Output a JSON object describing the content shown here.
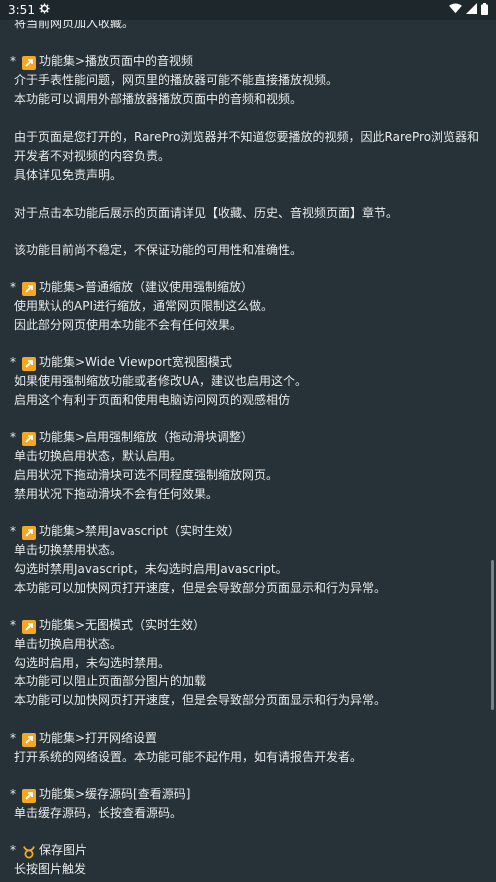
{
  "status_bar": {
    "time": "3:51"
  },
  "content": {
    "intro_tail": "将当前网页加入收藏。",
    "media": {
      "title": "功能集>播放页面中的音视频",
      "l1": "介于手表性能问题，网页里的播放器可能不能直接播放视频。",
      "l2": "本功能可以调用外部播放器播放页面中的音频和视频。",
      "disclaimer": "由于页面是您打开的，RarePro浏览器并不知道您要播放的视频，因此RarePro浏览器和开发者不对视频的内容负责。",
      "detail": "具体详见免责声明。",
      "see_also": "对于点击本功能后展示的页面请详见【收藏、历史、音视频页面】章节。",
      "unstable": "该功能目前尚不稳定，不保证功能的可用性和准确性。"
    },
    "zoom": {
      "title": "功能集>普通缩放（建议使用强制缩放）",
      "l1": "使用默认的API进行缩放，通常网页限制这么做。",
      "l2": "因此部分网页使用本功能不会有任何效果。"
    },
    "viewport": {
      "title": "功能集>Wide Viewport宽视图模式",
      "l1": "如果使用强制缩放功能或者修改UA，建议也启用这个。",
      "l2": "启用这个有利于页面和使用电脑访问网页的观感相仿"
    },
    "force_zoom": {
      "title": "功能集>启用强制缩放（拖动滑块调整）",
      "l1": "单击切换启用状态，默认启用。",
      "l2": "启用状况下拖动滑块可选不同程度强制缩放网页。",
      "l3": "禁用状况下拖动滑块不会有任何效果。"
    },
    "js": {
      "title": "功能集>禁用Javascript（实时生效）",
      "l1": "单击切换禁用状态。",
      "l2": "勾选时禁用Javascript，未勾选时启用Javascript。",
      "l3": "本功能可以加快网页打开速度，但是会导致部分页面显示和行为异常。"
    },
    "noimg": {
      "title": "功能集>无图模式（实时生效）",
      "l1": "单击切换启用状态。",
      "l2": "勾选时启用，未勾选时禁用。",
      "l3": "本功能可以阻止页面部分图片的加载",
      "l4": "本功能可以加快网页打开速度，但是会导致部分页面显示和行为异常。"
    },
    "network": {
      "title": "功能集>打开网络设置",
      "l1": "打开系统的网络设置。本功能可能不起作用，如有请报告开发者。"
    },
    "source": {
      "title": "功能集>缓存源码[查看源码]",
      "l1": "单击缓存源码，长按查看源码。"
    },
    "save_img": {
      "title": "保存图片",
      "l1": "长按图片触发"
    },
    "bullet": "*"
  }
}
